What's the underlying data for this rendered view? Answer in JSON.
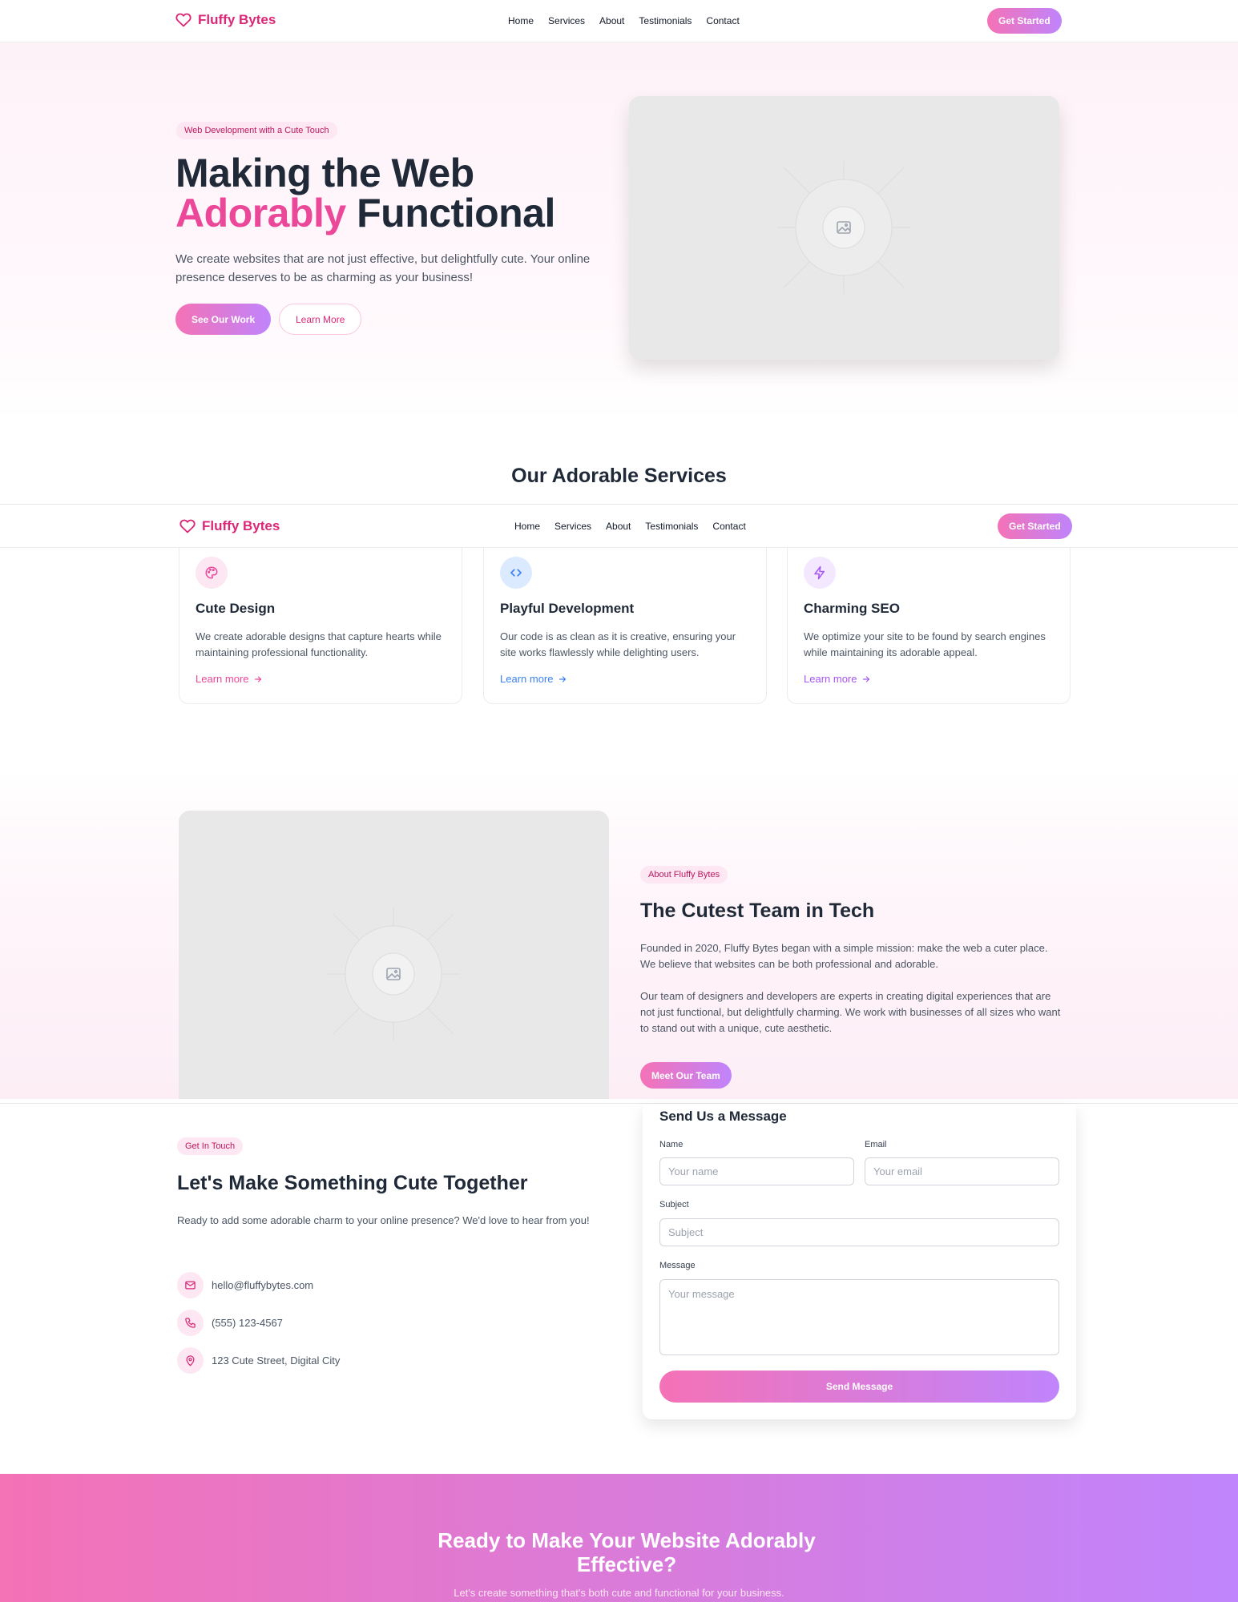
{
  "brand": {
    "name": "Fluffy Bytes",
    "accent": "#db2777",
    "gradient": [
      "#f472b6",
      "#c084fc"
    ]
  },
  "nav": {
    "links": [
      "Home",
      "Services",
      "About",
      "Testimonials",
      "Contact"
    ],
    "cta": "Get Started"
  },
  "hero": {
    "badge": "Web Development with a Cute Touch",
    "title_line1": "Making the Web",
    "title_accent": "Adorably",
    "title_rest": "Functional",
    "lead": "We create websites that are not just effective, but delightfully cute. Your online presence deserves to be as charming as your business!",
    "primary_button": "See Our Work",
    "secondary_button": "Learn More"
  },
  "services": {
    "title": "Our Adorable Services",
    "items": [
      {
        "icon": "palette-icon",
        "color": "#ec4899",
        "bg": "#fce7f3",
        "title": "Cute Design",
        "desc": "We create adorable designs that capture hearts while maintaining professional functionality.",
        "link": "Learn more"
      },
      {
        "icon": "code-icon",
        "color": "#3b82f6",
        "bg": "#dbeafe",
        "title": "Playful Development",
        "desc": "Our code is as clean as it is creative, ensuring your site works flawlessly while delighting users.",
        "link": "Learn more"
      },
      {
        "icon": "lightning-icon",
        "color": "#a855f7",
        "bg": "#f3e8ff",
        "title": "Charming SEO",
        "desc": "We optimize your site to be found by search engines while maintaining its adorable appeal.",
        "link": "Learn more"
      }
    ]
  },
  "about": {
    "badge": "About Fluffy Bytes",
    "title": "The Cutest Team in Tech",
    "p1": "Founded in 2020, Fluffy Bytes began with a simple mission: make the web a cuter place. We believe that websites can be both professional and adorable.",
    "p2": "Our team of designers and developers are experts in creating digital experiences that are not just functional, but delightfully charming. We work with businesses of all sizes who want to stand out with a unique, cute aesthetic.",
    "button": "Meet Our Team"
  },
  "contact": {
    "badge": "Get In Touch",
    "title": "Let's Make Something Cute Together",
    "intro": "Ready to add some adorable charm to your online presence? We'd love to hear from you!",
    "email": "hello@fluffybytes.com",
    "phone": "(555) 123-4567",
    "address": "123 Cute Street, Digital City",
    "form": {
      "title": "Send Us a Message",
      "name_label": "Name",
      "name_placeholder": "Your name",
      "email_label": "Email",
      "email_placeholder": "Your email",
      "subject_label": "Subject",
      "subject_placeholder": "Subject",
      "message_label": "Message",
      "message_placeholder": "Your message",
      "submit": "Send Message"
    }
  },
  "cta_band": {
    "title": "Ready to Make Your Website Adorably Effective?",
    "subtitle": "Let's create something that's both cute and functional for your business."
  }
}
